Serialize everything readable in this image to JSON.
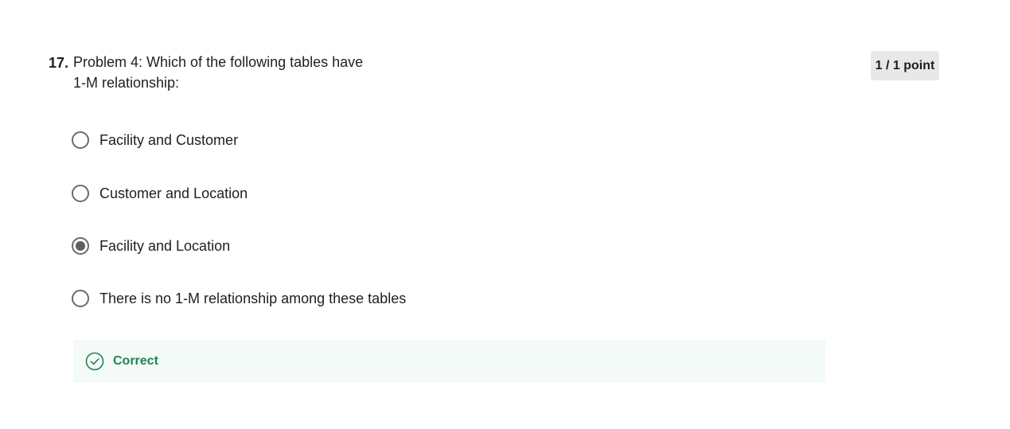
{
  "question": {
    "number": "17.",
    "text_line1": "Problem 4: Which of the following tables have",
    "text_line2": "1-M relationship:",
    "points": "1 / 1 point"
  },
  "options": [
    {
      "label": "Facility and Customer",
      "selected": false
    },
    {
      "label": "Customer and Location",
      "selected": false
    },
    {
      "label": "Facility and Location",
      "selected": true
    },
    {
      "label": "There is no 1-M relationship among these tables",
      "selected": false
    }
  ],
  "feedback": {
    "status": "Correct",
    "icon": "check-circle-icon",
    "color": "#1f8354"
  }
}
